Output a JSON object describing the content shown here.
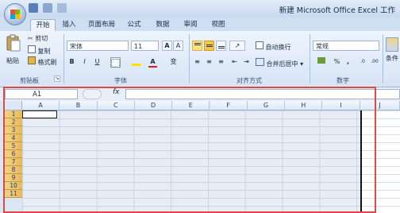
{
  "window": {
    "title": "新建 Microsoft Office Excel 工作"
  },
  "tabs": [
    "开始",
    "插入",
    "页面布局",
    "公式",
    "数据",
    "审阅",
    "视图"
  ],
  "clipboard": {
    "paste": "粘贴",
    "cut": "剪切",
    "copy": "复制",
    "format_painter": "格式刷",
    "label": "剪贴板"
  },
  "font": {
    "name": "宋体",
    "size": "11",
    "grow": "A",
    "shrink": "A",
    "bold": "B",
    "italic": "I",
    "underline": "U",
    "color_letter": "A",
    "label": "字体"
  },
  "alignment": {
    "wrap_text": "自动换行",
    "merge_center": "合并后居中",
    "label": "对齐方式"
  },
  "number": {
    "format": "常规",
    "percent": "%",
    "comma": ",",
    "label": "数字"
  },
  "styles": {
    "label": "条件"
  },
  "formula_bar": {
    "name_box": "A1",
    "fx": "fx",
    "content": ""
  },
  "grid": {
    "columns": [
      "A",
      "B",
      "C",
      "D",
      "E",
      "F",
      "G",
      "H",
      "I"
    ],
    "extra_column": "J",
    "rows": [
      "1",
      "2",
      "3",
      "4",
      "5",
      "6",
      "7",
      "8",
      "9",
      "10",
      "11"
    ]
  },
  "colors": {
    "accent": "#e04848",
    "row_header": "#e9b85a",
    "ribbon": "#dbe6f4"
  }
}
